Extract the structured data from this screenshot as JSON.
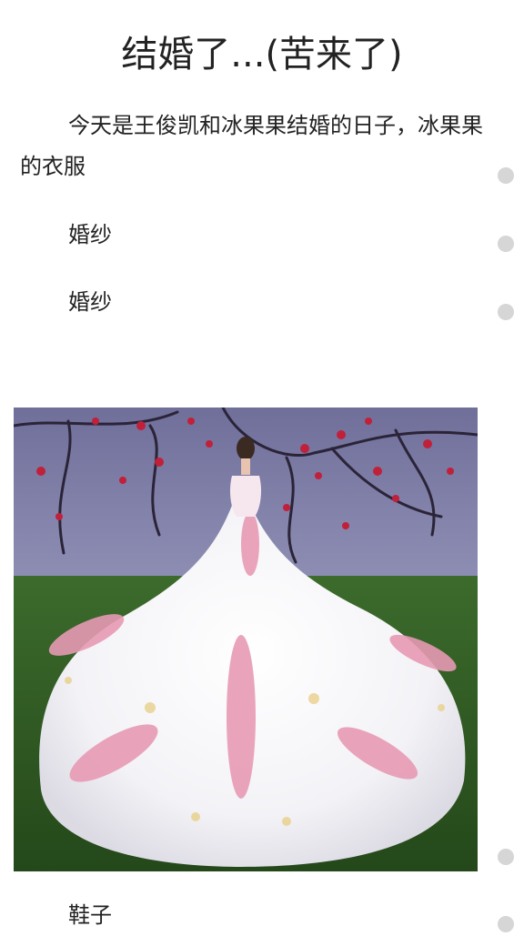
{
  "article": {
    "title": "结婚了...(苦来了)",
    "paragraphs": [
      "今天是王俊凯和冰果果结婚的日子，冰果果的衣服",
      "婚纱",
      "婚纱",
      "鞋子"
    ]
  },
  "colors": {
    "background": "#ffffff",
    "text": "#222222",
    "dot": "#d6d6d6",
    "wall": "#7f7fa8",
    "grass": "#2e5a22",
    "dress": "#f4f3f6",
    "flowers": "#e8a0b8"
  }
}
